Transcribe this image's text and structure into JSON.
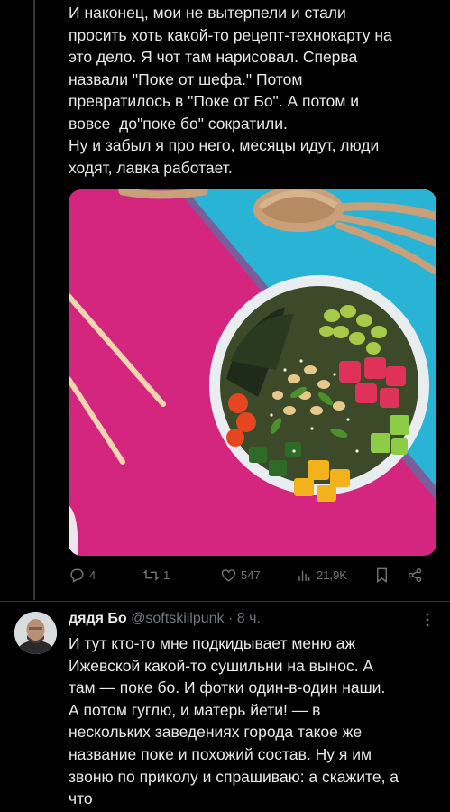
{
  "tweet": {
    "lines": [
      "И наконец, мои не вытерпели и стали",
      "просить хоть какой-то рецепт-технокарту на",
      "это дело. Я чот там нарисовал. Сперва",
      "назвали \"Поке от шефа.\" Потом",
      "превратилось в \"Поке от Бо\". А потом и",
      "вовсе  до\"поке бо\" сократили.",
      "Ну и забыл я про него, месяцы идут, люди",
      "ходят, лавка работает."
    ]
  },
  "actions": {
    "replies": "4",
    "retweets": "1",
    "likes": "547",
    "views": "21,9K"
  },
  "icons": {
    "reply": "reply-icon",
    "retweet": "retweet-icon",
    "like": "heart-icon",
    "views": "views-icon",
    "bookmark": "bookmark-icon",
    "share": "share-icon",
    "more": "more-icon"
  },
  "reply": {
    "name": "дядя Бо",
    "handle": "@softskillpunk",
    "separator": "·",
    "time": "8 ч.",
    "lines": [
      "И тут кто-то мне подкидывает меню аж",
      "Ижевской какой-то сушильни на вынос. А",
      "там — поке бо. И фотки один-в-один наши.",
      "А потом гуглю, и матерь йети! — в",
      "нескольких заведениях города такое же",
      "название поке и похожий состав. Ну я им",
      "звоню по приколу и спрашиваю: а скажите, а",
      "что"
    ]
  },
  "colors": {
    "background": "#000000",
    "text": "#e7e9ea",
    "muted": "#71767b",
    "magenta": "#d4267f",
    "cyan": "#29b4d6"
  }
}
